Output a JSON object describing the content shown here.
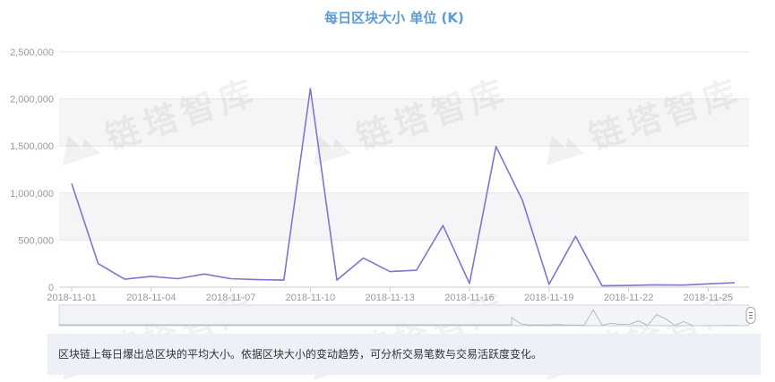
{
  "colors": {
    "title": "#5b9bd5",
    "line": "#8472d4",
    "grid": "#e6e6e6",
    "band": "#f5f5f7",
    "axis_text": "#9a9a9a",
    "navigator_line": "#aaaaaa",
    "desc_bg": "#eef0f7"
  },
  "watermark": {
    "text": "链塔智库",
    "icon": "triangle-logo-icon"
  },
  "navigator": {
    "handle_icon": "navigator-handle-icon"
  },
  "description": "区块链上每日爆出总区块的平均大小。依据区块大小的变动趋势，可分析交易笔数与交易活跃度变化。",
  "chart_data": {
    "type": "line",
    "title": "每日区块大小 单位 (K)",
    "xlabel": "",
    "ylabel": "",
    "ylim": [
      0,
      2500000
    ],
    "yticks": [
      0,
      500000,
      1000000,
      1500000,
      2000000,
      2500000
    ],
    "ytick_labels": [
      "0",
      "500,000",
      "1,000,000",
      "1,500,000",
      "2,000,000",
      "2,500,000"
    ],
    "xtick_labels": [
      "2018-11-01",
      "2018-11-04",
      "2018-11-07",
      "2018-11-10",
      "2018-11-13",
      "2018-11-16",
      "2018-11-19",
      "2018-11-22",
      "2018-11-25"
    ],
    "xtick_days": [
      1,
      4,
      7,
      10,
      13,
      16,
      19,
      22,
      25
    ],
    "grid": true,
    "legend": "none",
    "x": [
      "2018-11-01",
      "2018-11-02",
      "2018-11-03",
      "2018-11-04",
      "2018-11-05",
      "2018-11-06",
      "2018-11-07",
      "2018-11-08",
      "2018-11-09",
      "2018-11-10",
      "2018-11-11",
      "2018-11-12",
      "2018-11-13",
      "2018-11-14",
      "2018-11-15",
      "2018-11-16",
      "2018-11-17",
      "2018-11-18",
      "2018-11-19",
      "2018-11-20",
      "2018-11-21",
      "2018-11-22",
      "2018-11-23",
      "2018-11-24",
      "2018-11-25",
      "2018-11-26"
    ],
    "series": [
      {
        "values": [
          1100000,
          250000,
          85000,
          115000,
          90000,
          140000,
          90000,
          80000,
          75000,
          2110000,
          75000,
          310000,
          165000,
          180000,
          655000,
          40000,
          1495000,
          920000,
          30000,
          540000,
          15000,
          18000,
          25000,
          22000,
          35000,
          48000
        ]
      }
    ]
  }
}
